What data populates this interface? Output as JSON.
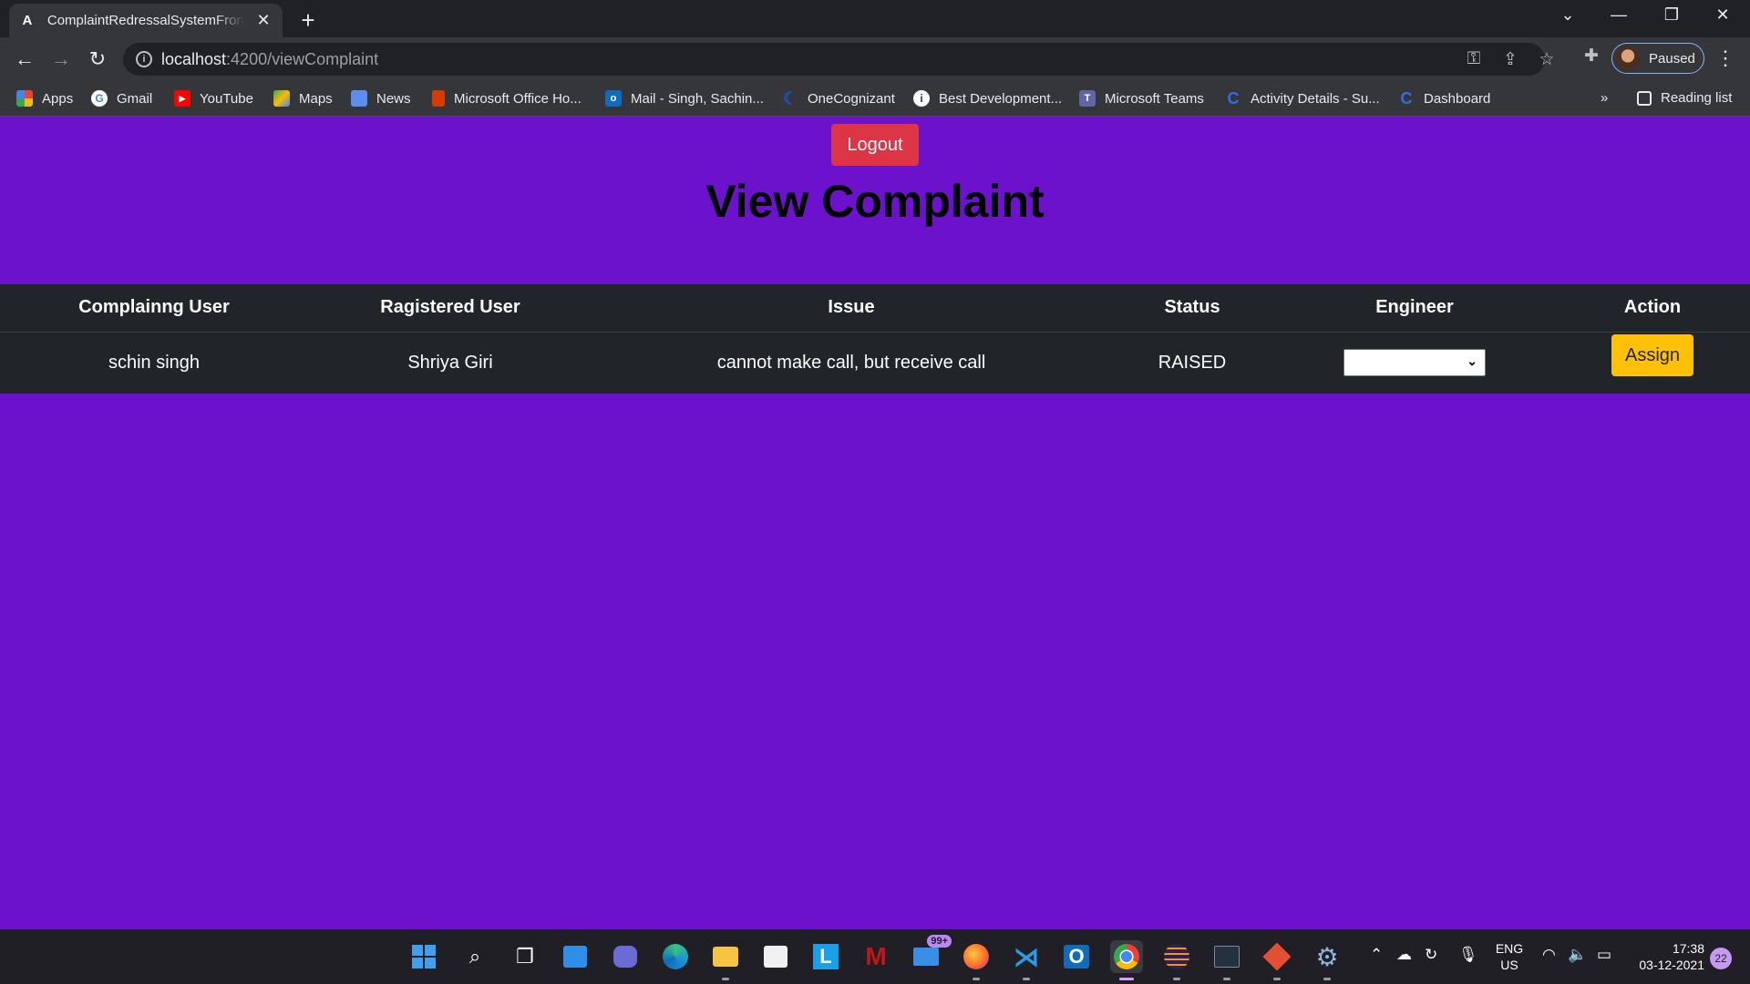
{
  "browser": {
    "tab_title": "ComplaintRedressalSystemFrontend",
    "tab_favicon": "A",
    "url_host": "localhost",
    "url_path": ":4200/viewComplaint",
    "profile_label": "Paused",
    "bookmarks": [
      {
        "label": "Apps",
        "icon": "apps-grid-icon",
        "color": "#ea4335"
      },
      {
        "label": "Gmail",
        "icon": "google-icon",
        "color": "#4285f4"
      },
      {
        "label": "YouTube",
        "icon": "youtube-icon",
        "color": "#ff0000"
      },
      {
        "label": "Maps",
        "icon": "maps-icon",
        "color": "#34a853"
      },
      {
        "label": "News",
        "icon": "news-icon",
        "color": "#5c8ef0"
      },
      {
        "label": "Microsoft Office Ho...",
        "icon": "office-icon",
        "color": "#d83b01"
      },
      {
        "label": "Mail - Singh, Sachin...",
        "icon": "outlook-icon",
        "color": "#0f6cbd"
      },
      {
        "label": "OneCognizant",
        "icon": "onecognizant-icon",
        "color": "#1a4fd6"
      },
      {
        "label": "Best Development...",
        "icon": "info-icon",
        "color": "#ffffff"
      },
      {
        "label": "Microsoft Teams",
        "icon": "teams-icon",
        "color": "#6264a7"
      },
      {
        "label": "Activity Details - Su...",
        "icon": "c-logo-icon",
        "color": "#2f6ef0"
      },
      {
        "label": "Dashboard",
        "icon": "c-logo-icon",
        "color": "#2f6ef0"
      }
    ],
    "reading_list": "Reading list",
    "overflow": "»"
  },
  "page": {
    "logout_label": "Logout",
    "title": "View Complaint",
    "table": {
      "headers": [
        "Complainng User",
        "Ragistered User",
        "Issue",
        "Status",
        "Engineer",
        "Action"
      ],
      "rows": [
        {
          "complaining_user": "schin singh",
          "registered_user": "Shriya Giri",
          "issue": "cannot make call, but receive call",
          "status": "RAISED",
          "engineer": "",
          "action": "Assign"
        }
      ]
    }
  },
  "taskbar": {
    "mail_badge": "99+",
    "lang_top": "ENG",
    "lang_bottom": "US",
    "time": "17:38",
    "date": "03-12-2021",
    "notifications": "22"
  }
}
